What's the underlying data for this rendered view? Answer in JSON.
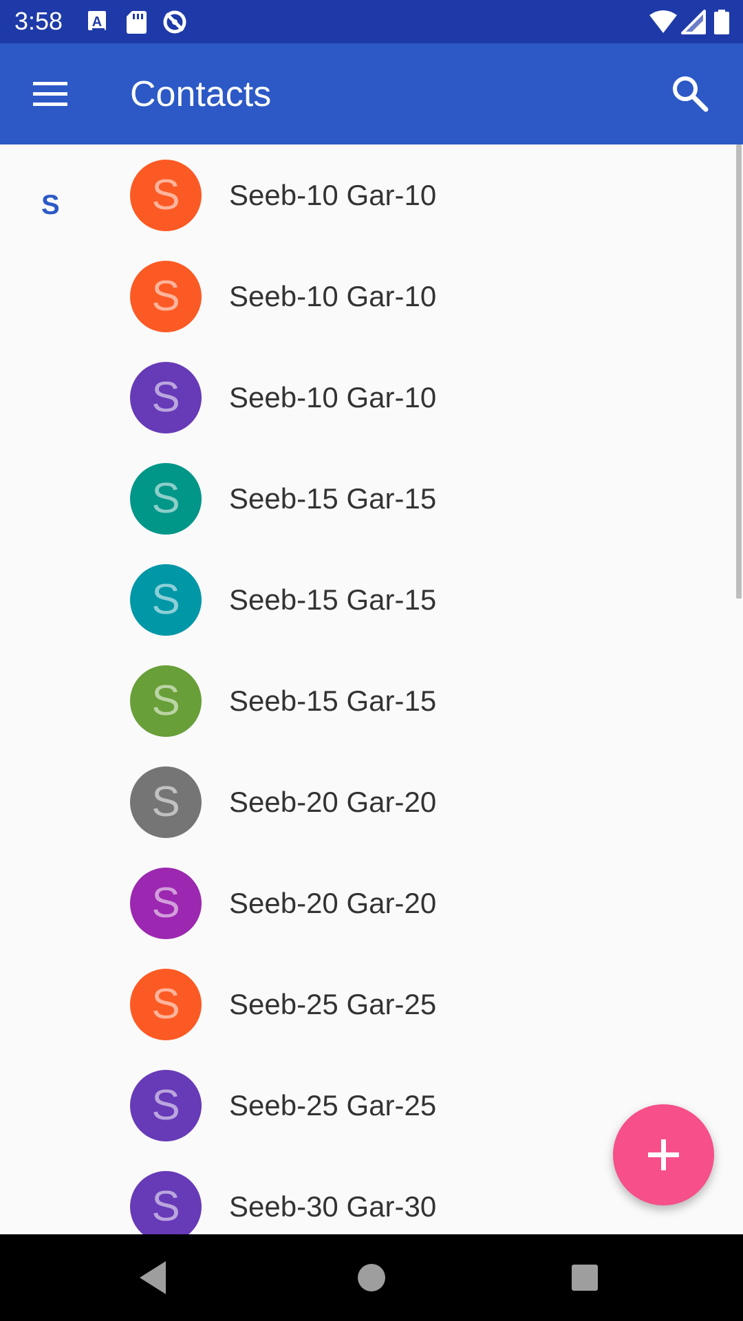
{
  "status_bar": {
    "time": "3:58",
    "left_icons": [
      "autofill-icon",
      "sd-card-icon",
      "location-off-icon"
    ],
    "right_icons": [
      "wifi-icon",
      "cell-signal-icon",
      "battery-icon"
    ],
    "background_color": "#1e3aa8"
  },
  "app_bar": {
    "title": "Contacts",
    "menu_icon": "menu-icon",
    "search_icon": "search-icon",
    "background_color": "#2c59c6"
  },
  "contacts": {
    "section_letter": "S",
    "items": [
      {
        "name": "Seeb-10 Gar-10",
        "initial": "S",
        "color": "#fc5a24"
      },
      {
        "name": "Seeb-10 Gar-10",
        "initial": "S",
        "color": "#fc5a24"
      },
      {
        "name": "Seeb-10 Gar-10",
        "initial": "S",
        "color": "#673ab7"
      },
      {
        "name": "Seeb-15 Gar-15",
        "initial": "S",
        "color": "#009688"
      },
      {
        "name": "Seeb-15 Gar-15",
        "initial": "S",
        "color": "#0097a7"
      },
      {
        "name": "Seeb-15 Gar-15",
        "initial": "S",
        "color": "#689f38"
      },
      {
        "name": "Seeb-20 Gar-20",
        "initial": "S",
        "color": "#757575"
      },
      {
        "name": "Seeb-20 Gar-20",
        "initial": "S",
        "color": "#9c27b0"
      },
      {
        "name": "Seeb-25 Gar-25",
        "initial": "S",
        "color": "#fc5a24"
      },
      {
        "name": "Seeb-25 Gar-25",
        "initial": "S",
        "color": "#673ab7"
      },
      {
        "name": "Seeb-30 Gar-30",
        "initial": "S",
        "color": "#673ab7"
      }
    ]
  },
  "fab": {
    "icon": "add-icon",
    "color": "#f64f8a"
  },
  "nav_bar": {
    "icons": [
      "back-icon",
      "home-icon",
      "recents-icon"
    ]
  }
}
